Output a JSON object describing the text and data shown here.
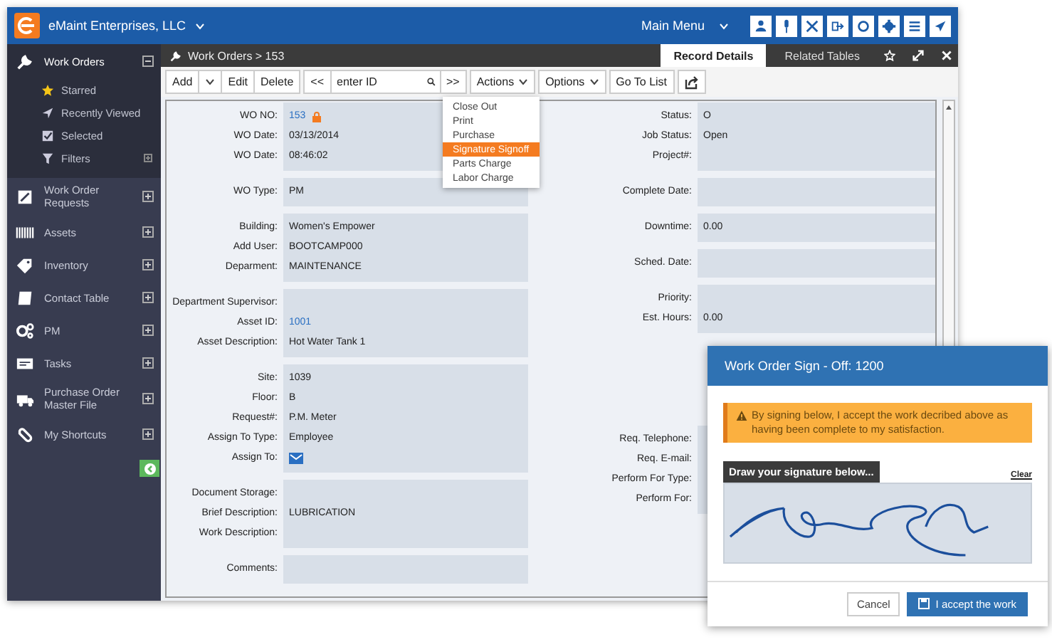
{
  "header": {
    "company": "eMaint Enterprises, LLC",
    "main_menu": "Main Menu"
  },
  "sidebar": {
    "items": [
      {
        "label": "Work Orders",
        "expanded": true,
        "children": [
          {
            "label": "Starred"
          },
          {
            "label": "Recently Viewed"
          },
          {
            "label": "Selected"
          },
          {
            "label": "Filters"
          }
        ]
      },
      {
        "label": "Work Order Requests",
        "expanded": false
      },
      {
        "label": "Assets",
        "expanded": false
      },
      {
        "label": "Inventory",
        "expanded": false
      },
      {
        "label": "Contact Table",
        "expanded": false
      },
      {
        "label": "PM",
        "expanded": false
      },
      {
        "label": "Tasks",
        "expanded": false
      },
      {
        "label": "Purchase Order Master File",
        "expanded": false
      },
      {
        "label": "My Shortcuts",
        "expanded": false
      }
    ]
  },
  "breadcrumb": "Work Orders > 153",
  "tabs": [
    {
      "label": "Record Details",
      "selected": true
    },
    {
      "label": "Related Tables",
      "selected": false
    }
  ],
  "toolbar": {
    "add": "Add",
    "edit": "Edit",
    "delete": "Delete",
    "prev": "<<",
    "search": {
      "placeholder": "enter ID"
    },
    "next": ">>",
    "actions": "Actions",
    "options": "Options",
    "go_to_list": "Go To List"
  },
  "actions_menu": {
    "items": [
      {
        "label": "Close Out",
        "selected": false
      },
      {
        "label": "Print",
        "selected": false
      },
      {
        "label": "Purchase",
        "selected": false
      },
      {
        "label": "Signature Signoff",
        "selected": true
      },
      {
        "label": "Parts Charge",
        "selected": false
      },
      {
        "label": "Labor Charge",
        "selected": false
      }
    ]
  },
  "form": {
    "left": [
      {
        "fields": [
          {
            "label": "WO NO:",
            "value": "153",
            "kind": "locked_link"
          },
          {
            "label": "WO Date:",
            "value": "03/13/2014",
            "kind": "text"
          },
          {
            "label": "WO Date:",
            "value": "08:46:02",
            "kind": "text"
          }
        ]
      },
      {
        "fields": [
          {
            "label": "WO Type:",
            "value": "PM",
            "kind": "text"
          }
        ]
      },
      {
        "fields": [
          {
            "label": "Building:",
            "value": "Women's Empower",
            "kind": "text"
          },
          {
            "label": "Add User:",
            "value": "BOOTCAMP000",
            "kind": "text"
          },
          {
            "label": "Deparment:",
            "value": "MAINTENANCE",
            "kind": "text"
          }
        ]
      },
      {
        "fields": [
          {
            "label": "Department Supervisor:",
            "kind": "text"
          },
          {
            "label": "Asset ID:",
            "value": "1001",
            "kind": "link"
          },
          {
            "label": "Asset Description:",
            "value": "Hot Water Tank 1",
            "kind": "text"
          }
        ]
      },
      {
        "fields": [
          {
            "label": "Site:",
            "value": "1039",
            "kind": "text"
          },
          {
            "label": "Floor:",
            "value": "B",
            "kind": "text"
          },
          {
            "label": "Request#:",
            "value": "P.M. Meter",
            "kind": "text"
          },
          {
            "label": "Assign To Type:",
            "value": "Employee",
            "kind": "text"
          },
          {
            "label": "Assign To:",
            "kind": "mail"
          }
        ]
      },
      {
        "fields": [
          {
            "label": "Document Storage:",
            "kind": "text"
          },
          {
            "label": "Brief Description:",
            "value": "LUBRICATION",
            "kind": "text"
          },
          {
            "label": "Work Description:",
            "kind": "text"
          }
        ]
      },
      {
        "fields": [
          {
            "label": "Comments:",
            "kind": "text"
          }
        ]
      }
    ],
    "right": [
      {
        "fields": [
          {
            "label": "Status:",
            "value": "O",
            "kind": "text"
          },
          {
            "label": "Job Status:",
            "value": "Open",
            "kind": "text"
          },
          {
            "label": "Project#:",
            "kind": "text"
          }
        ]
      },
      {
        "fields": [
          {
            "label": "Complete Date:",
            "kind": "text"
          }
        ]
      },
      {
        "fields": [
          {
            "label": "Downtime:",
            "value": "0.00",
            "kind": "text"
          }
        ]
      },
      {
        "fields": [
          {
            "label": "Sched. Date:",
            "kind": "text"
          }
        ]
      },
      {
        "fields": [
          {
            "label": "Priority:",
            "kind": "text"
          },
          {
            "label": "Est. Hours:",
            "value": "0.00",
            "kind": "text"
          }
        ]
      },
      {
        "fields": [
          {
            "label": "Req. Telephone:",
            "kind": "text"
          },
          {
            "label": "Req. E-mail:",
            "kind": "text"
          },
          {
            "label": "Perform For Type:",
            "kind": "text"
          },
          {
            "label": "Perform For:",
            "kind": "text"
          }
        ]
      }
    ]
  },
  "dialog": {
    "title": "Work Order Sign - Off: 1200",
    "warning": "By signing below, I accept the work decribed above as having been complete to my satisfaction.",
    "signature_label": "Draw your signature below...",
    "clear": "Clear",
    "cancel": "Cancel",
    "accept": "I accept the work"
  }
}
